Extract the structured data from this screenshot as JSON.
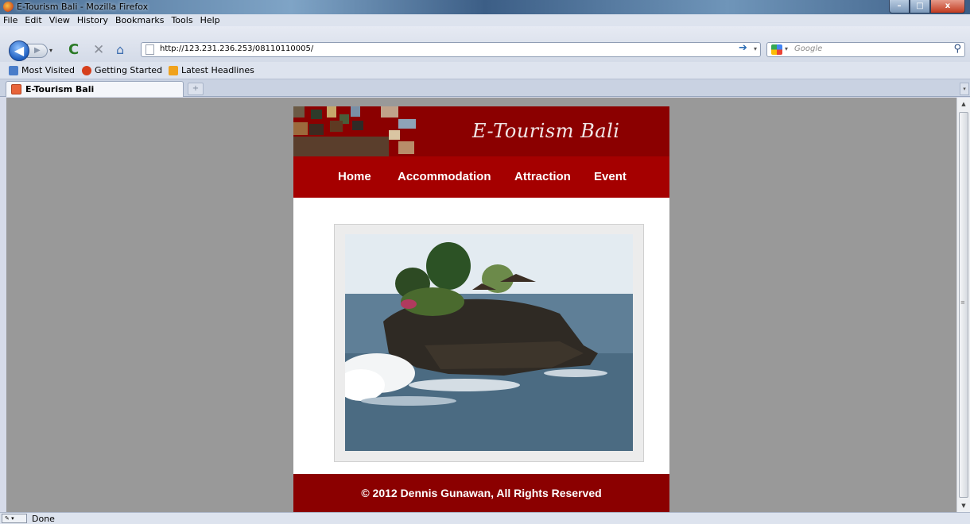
{
  "window": {
    "title": "E-Tourism Bali - Mozilla Firefox",
    "minimize": "–",
    "maximize": "□",
    "close": "x"
  },
  "menu": [
    "File",
    "Edit",
    "View",
    "History",
    "Bookmarks",
    "Tools",
    "Help"
  ],
  "toolbar": {
    "back": "◀",
    "forward": "▶",
    "dropdown": "▾",
    "reload": "C",
    "stop": "✕",
    "home": "⌂",
    "url": "http://123.231.236.253/08110110005/",
    "go": "➔",
    "url_dropdown": "▾",
    "search_placeholder": "Google",
    "search_engine_dropdown": "▾",
    "search_button": "⚲"
  },
  "bookmarks": [
    {
      "label": "Most Visited",
      "color": "#4a7dc9"
    },
    {
      "label": "Getting Started",
      "color": "#d63f1c"
    },
    {
      "label": "Latest Headlines",
      "color": "#f0a21c"
    }
  ],
  "tabs": {
    "active_label": "E-Tourism Bali",
    "new_tab": "+",
    "list": "▾"
  },
  "site": {
    "title": "E-Tourism Bali",
    "nav": [
      "Home",
      "Accommodation",
      "Attraction",
      "Event"
    ],
    "footer": "© 2012 Dennis Gunawan, All Rights Reserved",
    "colors": {
      "header": "#8b0000",
      "nav": "#a50000",
      "background": "#999999"
    }
  },
  "scrollbar": {
    "up": "▲",
    "down": "▼",
    "grip": "≡"
  },
  "status": {
    "text": "Done",
    "icon": "✎ ▾"
  }
}
